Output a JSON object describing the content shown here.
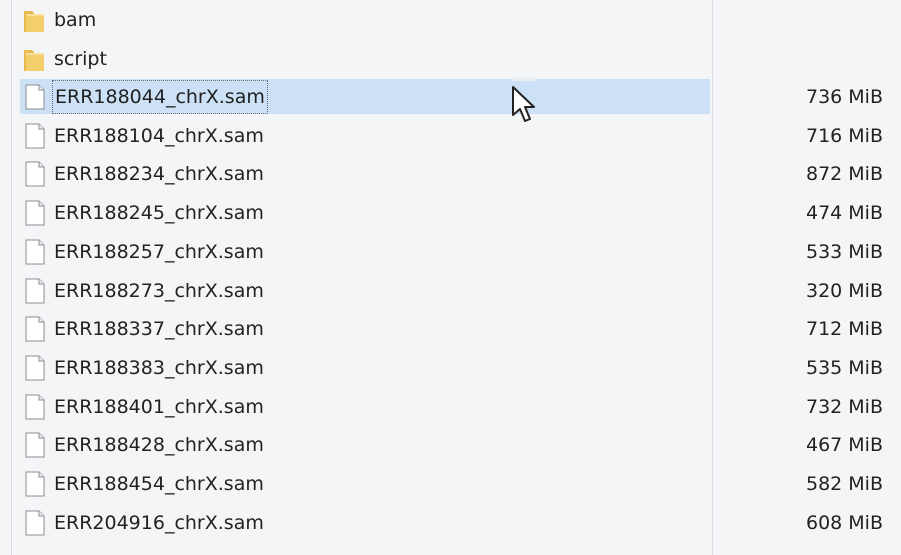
{
  "folders": [
    {
      "name": "bam",
      "icon": "folder-icon"
    },
    {
      "name": "script",
      "icon": "folder-icon"
    }
  ],
  "files": [
    {
      "name": "ERR188044_chrX.sam",
      "size": "736 MiB",
      "icon": "file-icon",
      "selected": true
    },
    {
      "name": "ERR188104_chrX.sam",
      "size": "716 MiB",
      "icon": "file-icon"
    },
    {
      "name": "ERR188234_chrX.sam",
      "size": "872 MiB",
      "icon": "file-icon"
    },
    {
      "name": "ERR188245_chrX.sam",
      "size": "474 MiB",
      "icon": "file-icon"
    },
    {
      "name": "ERR188257_chrX.sam",
      "size": "533 MiB",
      "icon": "file-icon"
    },
    {
      "name": "ERR188273_chrX.sam",
      "size": "320 MiB",
      "icon": "file-icon"
    },
    {
      "name": "ERR188337_chrX.sam",
      "size": "712 MiB",
      "icon": "file-icon"
    },
    {
      "name": "ERR188383_chrX.sam",
      "size": "535 MiB",
      "icon": "file-icon"
    },
    {
      "name": "ERR188401_chrX.sam",
      "size": "732 MiB",
      "icon": "file-icon"
    },
    {
      "name": "ERR188428_chrX.sam",
      "size": "467 MiB",
      "icon": "file-icon"
    },
    {
      "name": "ERR188454_chrX.sam",
      "size": "582 MiB",
      "icon": "file-icon"
    },
    {
      "name": "ERR204916_chrX.sam",
      "size": "608 MiB",
      "icon": "file-icon"
    }
  ],
  "colors": {
    "selection": "#cce0f6",
    "folder": "#f3cf6b",
    "background": "#f4f5f7"
  }
}
